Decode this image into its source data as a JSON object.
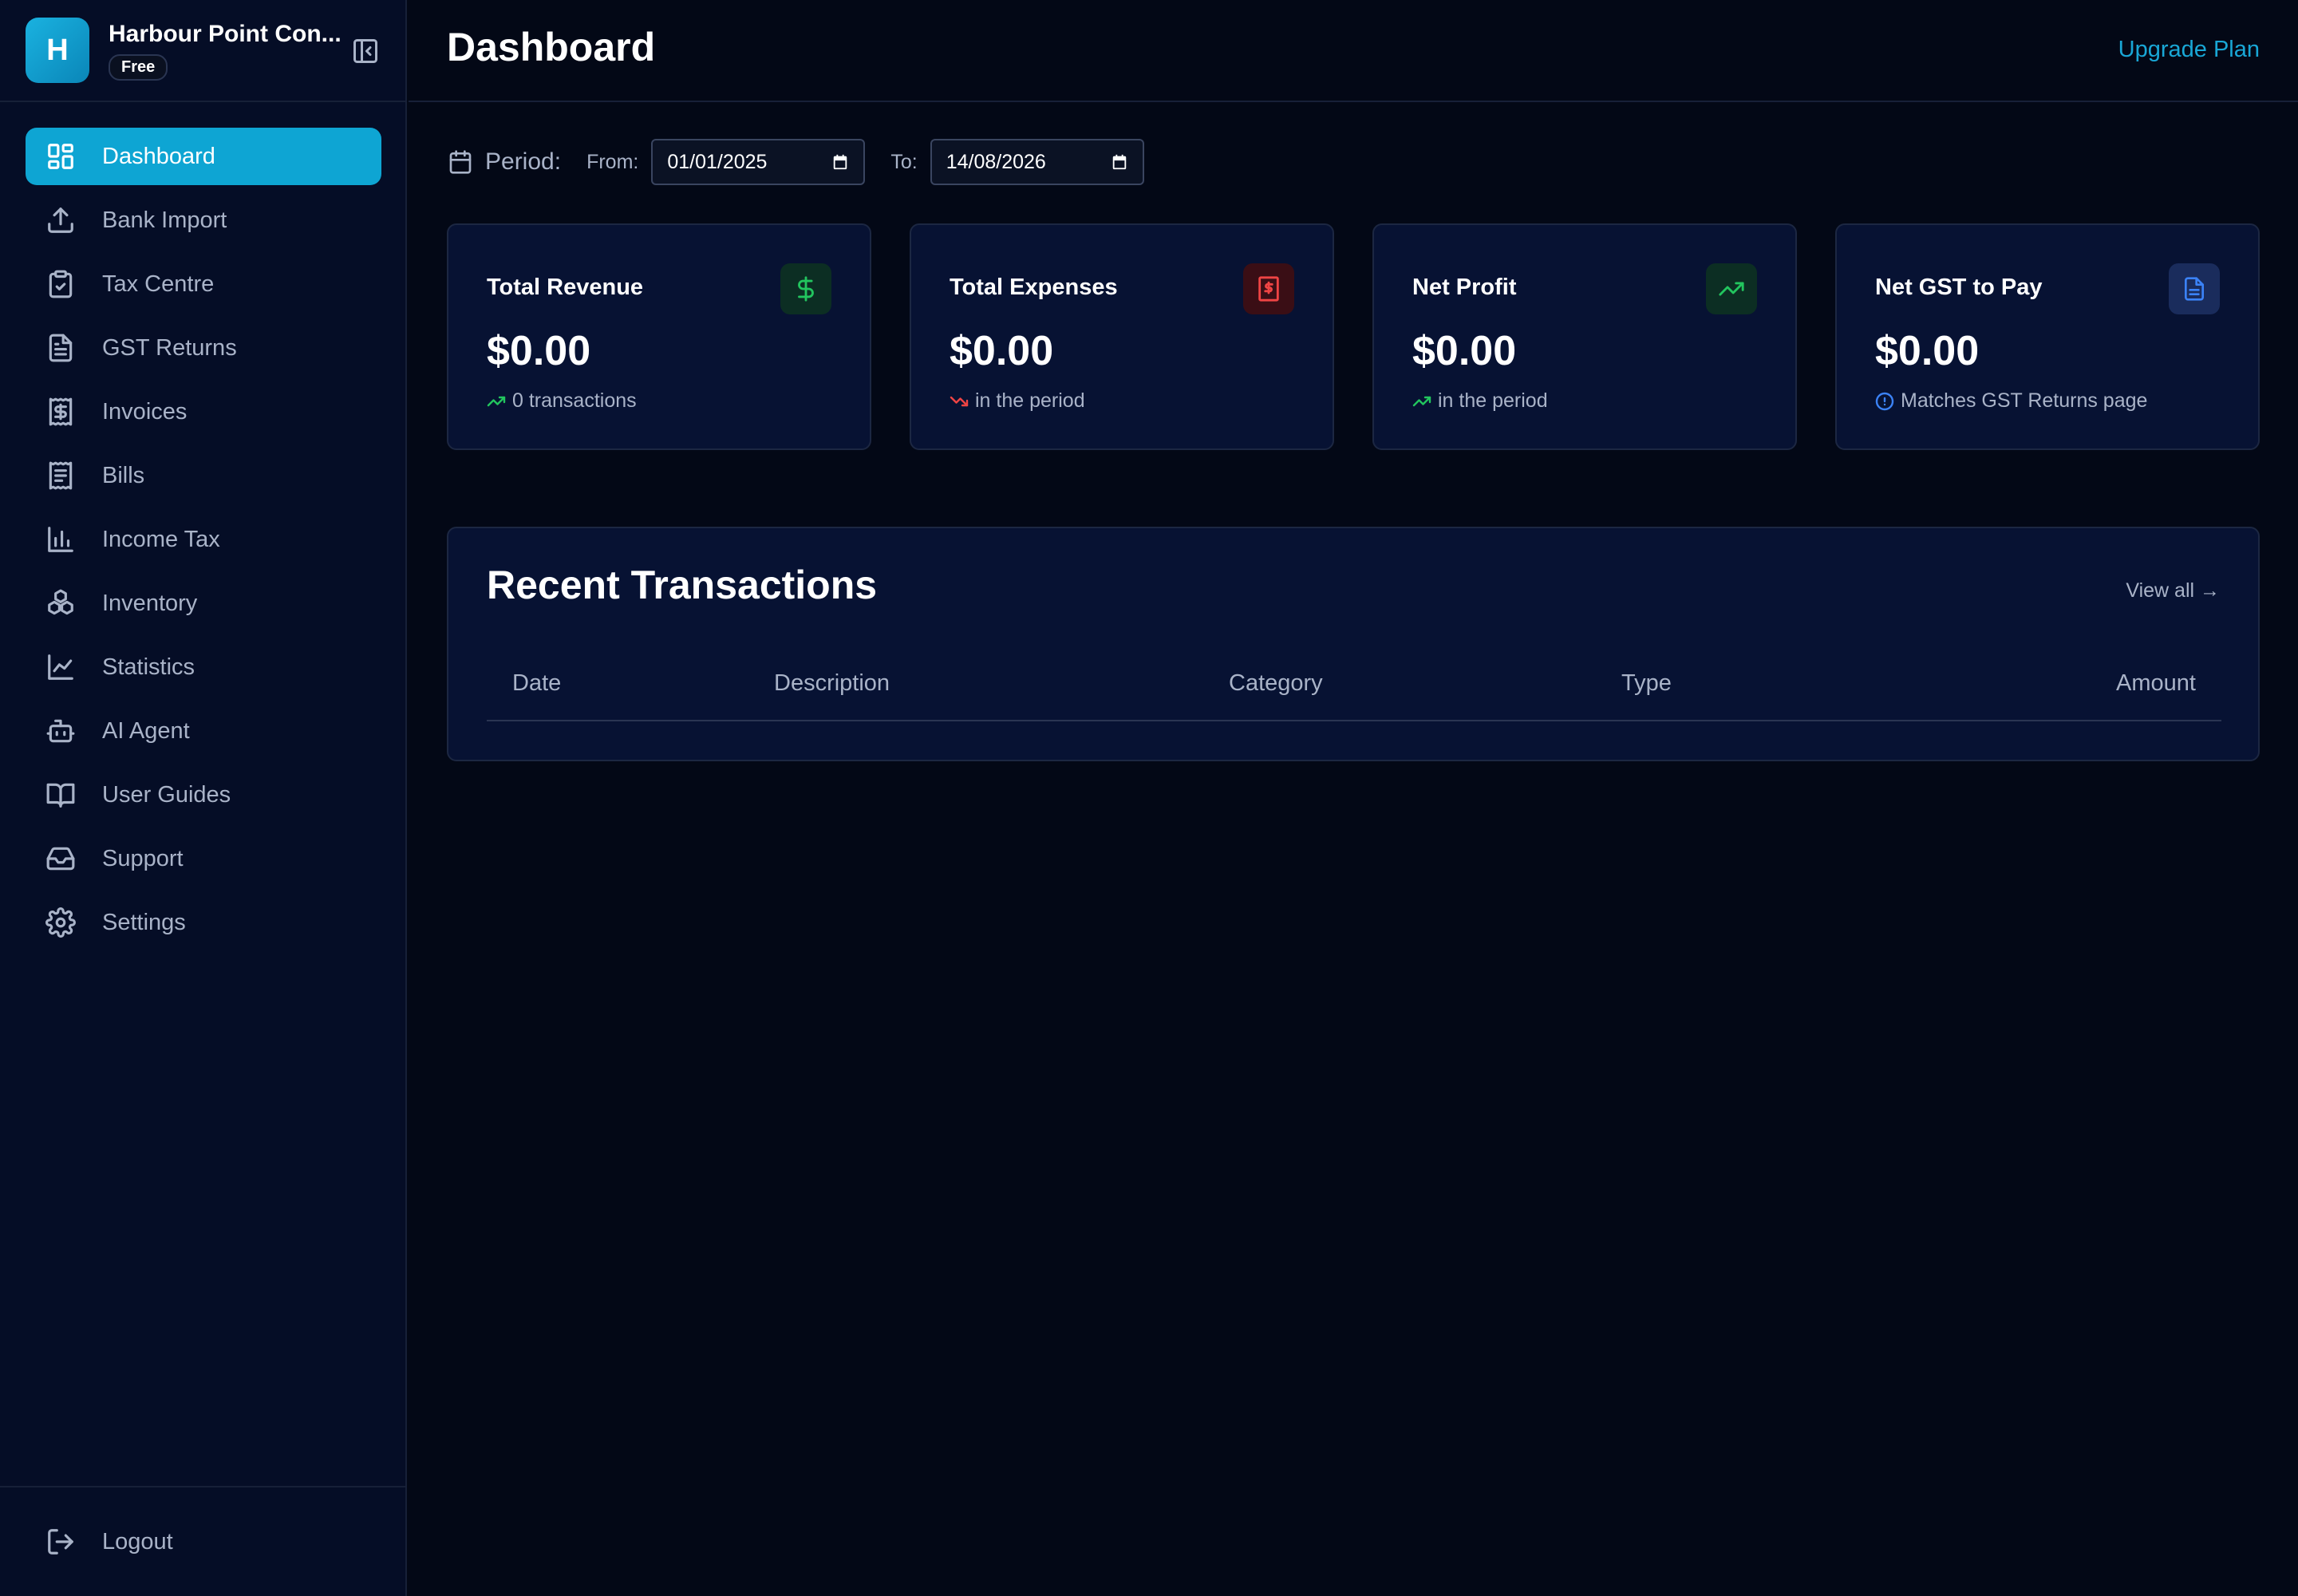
{
  "brand": {
    "initial": "H",
    "name": "Harbour Point Con...",
    "plan_badge": "Free",
    "accent": "#0ea5d3"
  },
  "sidebar": {
    "items": [
      {
        "label": "Dashboard",
        "icon": "dashboard-grid-icon",
        "active": true
      },
      {
        "label": "Bank Import",
        "icon": "upload-icon",
        "active": false
      },
      {
        "label": "Tax Centre",
        "icon": "clipboard-check-icon",
        "active": false
      },
      {
        "label": "GST Returns",
        "icon": "file-text-icon",
        "active": false
      },
      {
        "label": "Invoices",
        "icon": "receipt-dollar-icon",
        "active": false
      },
      {
        "label": "Bills",
        "icon": "receipt-icon",
        "active": false
      },
      {
        "label": "Income Tax",
        "icon": "bar-chart-icon",
        "active": false
      },
      {
        "label": "Inventory",
        "icon": "boxes-icon",
        "active": false
      },
      {
        "label": "Statistics",
        "icon": "line-chart-icon",
        "active": false
      },
      {
        "label": "AI Agent",
        "icon": "robot-icon",
        "active": false
      },
      {
        "label": "User Guides",
        "icon": "book-open-icon",
        "active": false
      },
      {
        "label": "Support",
        "icon": "inbox-icon",
        "active": false
      },
      {
        "label": "Settings",
        "icon": "gear-icon",
        "active": false
      }
    ],
    "logout_label": "Logout"
  },
  "header": {
    "title": "Dashboard",
    "upgrade_label": "Upgrade Plan"
  },
  "period": {
    "label": "Period:",
    "from_label": "From:",
    "from_value": "01/01/2025",
    "to_label": "To:",
    "to_value": "14/08/2026"
  },
  "cards": [
    {
      "title": "Total Revenue",
      "value": "$0.00",
      "sub": "0 transactions",
      "icon": "dollar-icon",
      "color": "#22c55e"
    },
    {
      "title": "Total Expenses",
      "value": "$0.00",
      "sub": "in the period",
      "icon": "receipt-dollar-icon",
      "color": "#ef4444"
    },
    {
      "title": "Net Profit",
      "value": "$0.00",
      "sub": "in the period",
      "icon": "trending-up-icon",
      "color": "#22c55e"
    },
    {
      "title": "Net GST to Pay",
      "value": "$0.00",
      "sub": "Matches GST Returns page",
      "icon": "file-text-icon",
      "color": "#3b82f6"
    }
  ],
  "recent": {
    "title": "Recent Transactions",
    "view_all": "View all →",
    "columns": [
      "Date",
      "Description",
      "Category",
      "Type",
      "Amount"
    ]
  }
}
